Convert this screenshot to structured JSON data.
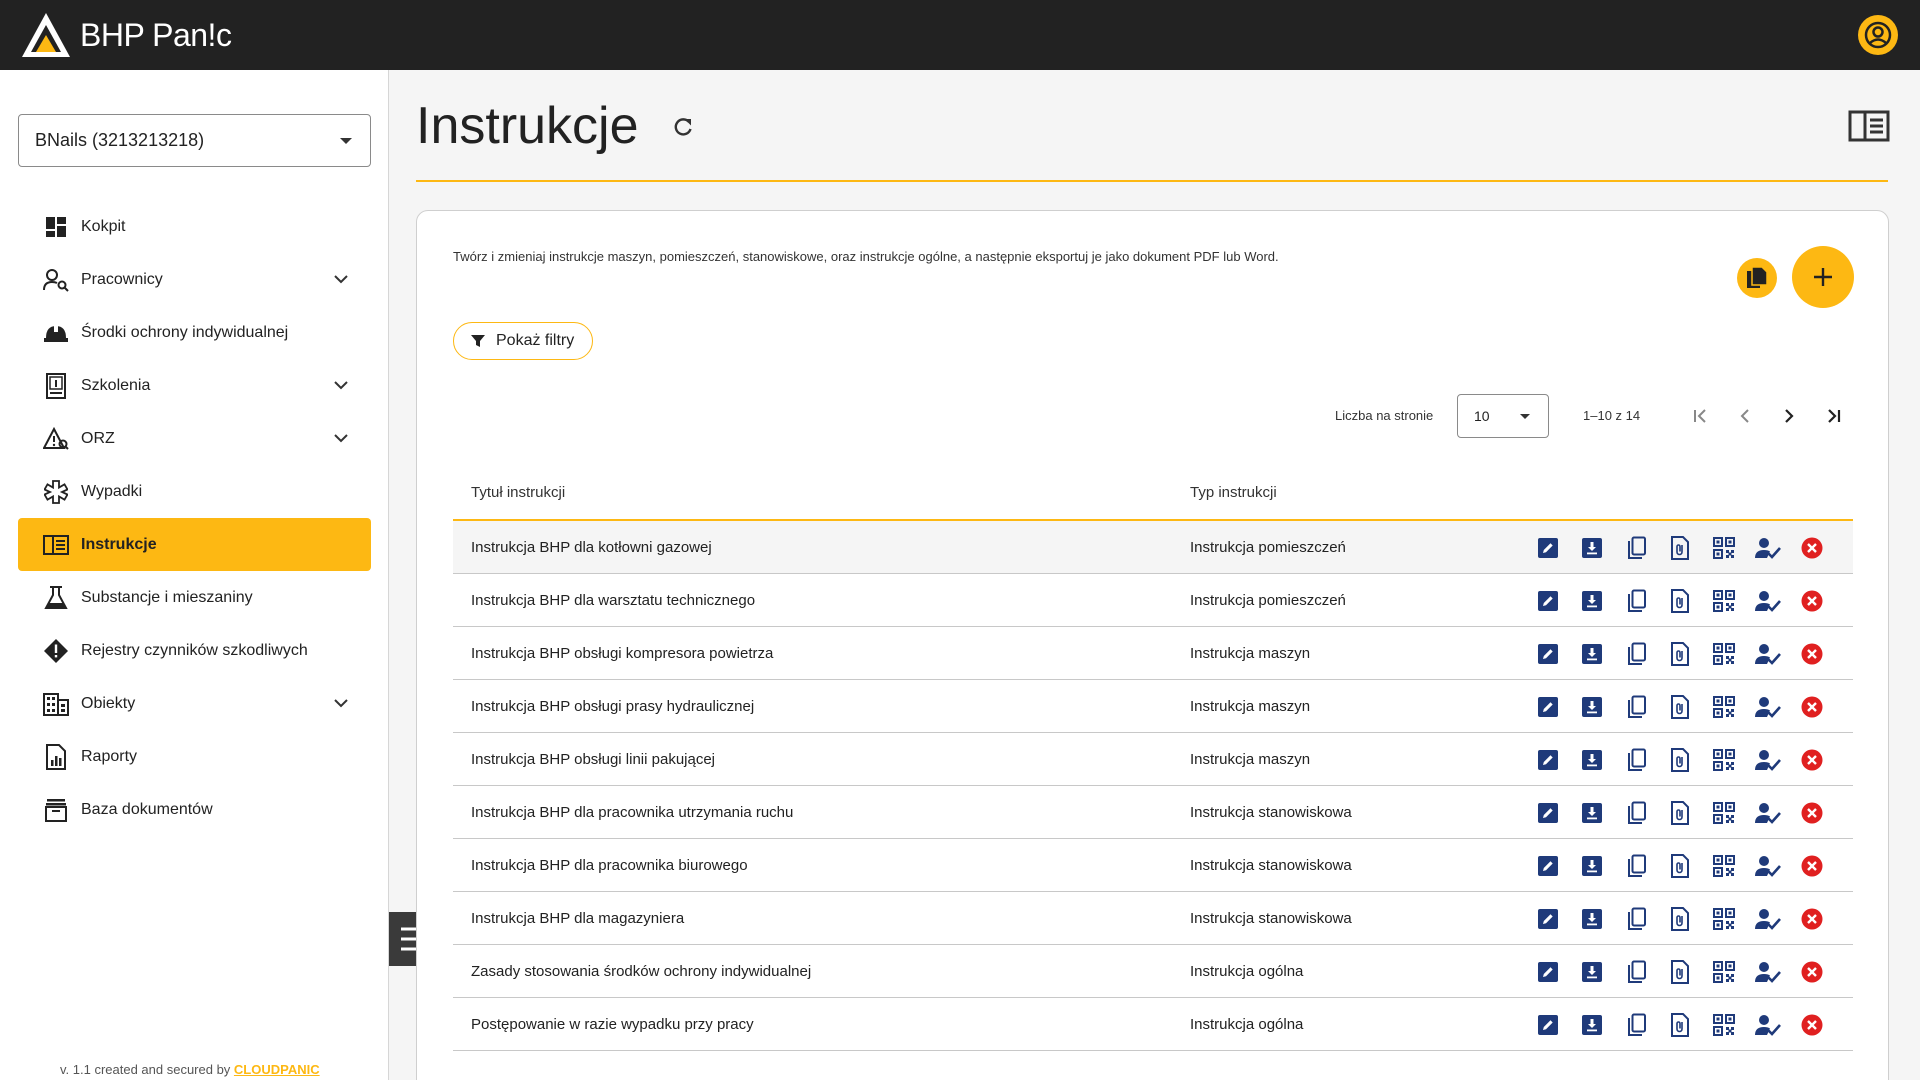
{
  "app": {
    "brand": "BHP Pan!c",
    "brand_color": "#fdb813",
    "dark": "#222222"
  },
  "sidebar": {
    "company": "BNails (3213213218)",
    "items": [
      {
        "label": "Kokpit",
        "icon": "dashboard-icon",
        "expandable": false,
        "active": false
      },
      {
        "label": "Pracownicy",
        "icon": "person-search-icon",
        "expandable": true,
        "active": false
      },
      {
        "label": "Środki ochrony indywidualnej",
        "icon": "helmet-icon",
        "expandable": false,
        "active": false
      },
      {
        "label": "Szkolenia",
        "icon": "training-book-icon",
        "expandable": true,
        "active": false
      },
      {
        "label": "ORZ",
        "icon": "risk-warning-icon",
        "expandable": true,
        "active": false
      },
      {
        "label": "Wypadki",
        "icon": "medical-star-icon",
        "expandable": false,
        "active": false
      },
      {
        "label": "Instrukcje",
        "icon": "instructions-book-icon",
        "expandable": false,
        "active": true
      },
      {
        "label": "Substancje i mieszaniny",
        "icon": "flask-icon",
        "expandable": false,
        "active": false
      },
      {
        "label": "Rejestry czynników szkodliwych",
        "icon": "alert-diamond-icon",
        "expandable": false,
        "active": false
      },
      {
        "label": "Obiekty",
        "icon": "building-icon",
        "expandable": true,
        "active": false
      },
      {
        "label": "Raporty",
        "icon": "report-icon",
        "expandable": false,
        "active": false
      },
      {
        "label": "Baza dokumentów",
        "icon": "archive-icon",
        "expandable": false,
        "active": false
      }
    ],
    "version_text": "v. 1.1 created and secured by ",
    "version_brand": "CLOUDPANIC"
  },
  "main": {
    "title": "Instrukcje",
    "description": "Twórz i zmieniaj instrukcje maszyn, pomieszczeń, stanowiskowe, oraz instrukcje ogólne, a następnie eksportuj je jako dokument PDF lub Word.",
    "filter_label": "Pokaż filtry",
    "pager": {
      "label": "Liczba na stronie",
      "page_size": "10",
      "range": "1–10 z 14"
    },
    "table": {
      "columns": [
        "Tytuł instrukcji",
        "Typ instrukcji"
      ],
      "rows": [
        {
          "title": "Instrukcja BHP dla kotłowni gazowej",
          "type": "Instrukcja pomieszczeń"
        },
        {
          "title": "Instrukcja BHP dla warsztatu technicznego",
          "type": "Instrukcja pomieszczeń"
        },
        {
          "title": "Instrukcja BHP obsługi kompresora powietrza",
          "type": "Instrukcja maszyn"
        },
        {
          "title": "Instrukcja BHP obsługi prasy hydraulicznej",
          "type": "Instrukcja maszyn"
        },
        {
          "title": "Instrukcja BHP obsługi linii pakującej",
          "type": "Instrukcja maszyn"
        },
        {
          "title": "Instrukcja BHP dla pracownika utrzymania ruchu",
          "type": "Instrukcja stanowiskowa"
        },
        {
          "title": "Instrukcja BHP dla pracownika biurowego",
          "type": "Instrukcja stanowiskowa"
        },
        {
          "title": "Instrukcja BHP dla magazyniera",
          "type": "Instrukcja stanowiskowa"
        },
        {
          "title": "Zasady stosowania środków ochrony indywidualnej",
          "type": "Instrukcja ogólna"
        },
        {
          "title": "Postępowanie w razie wypadku przy pracy",
          "type": "Instrukcja ogólna"
        }
      ],
      "row_actions": [
        "edit-icon",
        "download-icon",
        "copy-icon",
        "attachment-icon",
        "qr-code-icon",
        "assign-user-icon",
        "delete-icon"
      ],
      "action_color": "#1f3a7a",
      "delete_color": "#e02020"
    }
  }
}
